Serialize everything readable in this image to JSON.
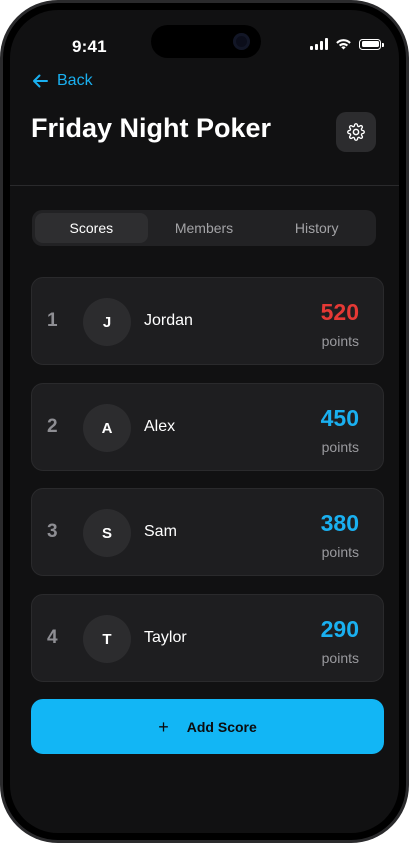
{
  "status_bar": {
    "time": "9:41"
  },
  "header": {
    "back_label": "Back",
    "title": "Friday Night Poker",
    "settings_icon": "gear-icon"
  },
  "tabs": [
    {
      "label": "Scores",
      "active": true
    },
    {
      "label": "Members",
      "active": false
    },
    {
      "label": "History",
      "active": false
    }
  ],
  "leaderboard": [
    {
      "rank": "1",
      "initial": "J",
      "name": "Jordan",
      "score": "520",
      "unit": "points",
      "color": "#e53935"
    },
    {
      "rank": "2",
      "initial": "A",
      "name": "Alex",
      "score": "450",
      "unit": "points",
      "color": "#1ab0f0"
    },
    {
      "rank": "3",
      "initial": "S",
      "name": "Sam",
      "score": "380",
      "unit": "points",
      "color": "#1ab0f0"
    },
    {
      "rank": "4",
      "initial": "T",
      "name": "Taylor",
      "score": "290",
      "unit": "points",
      "color": "#1ab0f0"
    }
  ],
  "actions": {
    "add_score_label": "Add Score",
    "add_icon": "plus-icon"
  },
  "colors": {
    "accent": "#12b6f5",
    "leader": "#e53935",
    "background": "#111112"
  }
}
